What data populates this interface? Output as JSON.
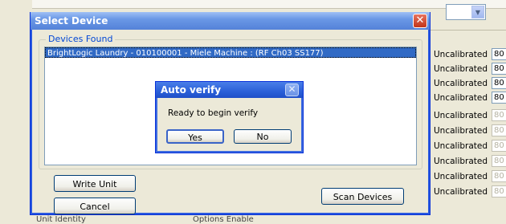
{
  "background": {
    "status_rows": [
      {
        "label": "Uncalibrated",
        "value": "80"
      },
      {
        "label": "Uncalibrated",
        "value": "80"
      },
      {
        "label": "Uncalibrated",
        "value": "80"
      },
      {
        "label": "Uncalibrated",
        "value": "80"
      },
      {
        "label": "Uncalibrated",
        "value": "80"
      },
      {
        "label": "Uncalibrated",
        "value": "80"
      },
      {
        "label": "Uncalibrated",
        "value": "80"
      },
      {
        "label": "Uncalibrated",
        "value": "80"
      },
      {
        "label": "Uncalibrated",
        "value": "80"
      },
      {
        "label": "Uncalibrated",
        "value": "80"
      }
    ],
    "bottom_left_label": "Unit Identity",
    "bottom_mid_label": "Options Enable"
  },
  "dialog": {
    "title": "Select Device",
    "close_glyph": "✕",
    "group_label": "Devices Found",
    "devices": [
      "BrightLogic Laundry - 010100001 - Miele Machine : (RF Ch03 SS177)"
    ],
    "write_unit_label": "Write Unit",
    "cancel_label": "Cancel",
    "scan_devices_label": "Scan Devices"
  },
  "modal": {
    "title": "Auto verify",
    "close_glyph": "✕",
    "message": "Ready to begin verify",
    "yes_label": "Yes",
    "no_label": "No"
  },
  "colors": {
    "selection": "#316ac5",
    "title_blue": "#2a5fd8",
    "close_red": "#c23418"
  }
}
